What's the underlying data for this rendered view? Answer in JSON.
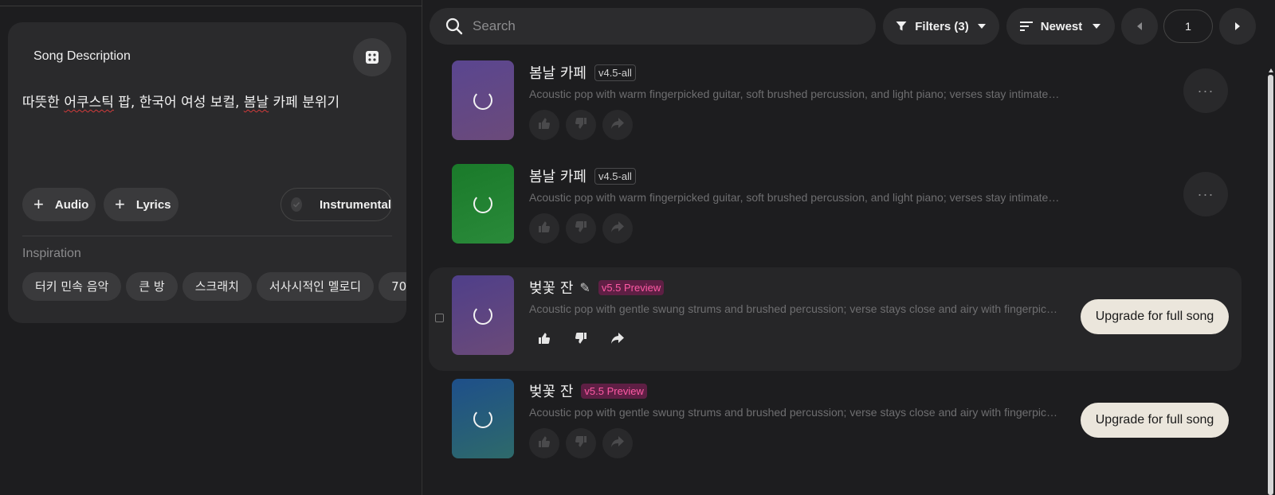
{
  "create_panel": {
    "title": "Song Description",
    "description": {
      "parts": [
        {
          "text": "따뜻한 ",
          "err": false
        },
        {
          "text": "어쿠스틱",
          "err": true
        },
        {
          "text": " 팝, 한국어 여성 보컬, ",
          "err": false
        },
        {
          "text": "봄날",
          "err": true
        },
        {
          "text": " 카페 분위기",
          "err": false
        }
      ]
    },
    "audio_label": "Audio",
    "lyrics_label": "Lyrics",
    "instrumental_label": "Instrumental",
    "inspiration_label": "Inspiration",
    "inspiration_chips": [
      "터키 민속 음악",
      "큰 방",
      "스크래치",
      "서사시적인 멜로디",
      "70"
    ]
  },
  "toolbar": {
    "search_placeholder": "Search",
    "filters_label": "Filters (3)",
    "sort_label": "Newest",
    "page": "1"
  },
  "songs": [
    {
      "title": "봄날 카페",
      "badge": "v4.5-all",
      "badge_style": "grey",
      "description": "Acoustic pop with warm fingerpicked guitar, soft brushed percussion, and light piano; verses stay intimate and warm while the chorus opens up with gentle harmonies",
      "cover": "#5a4690",
      "cover_end": "#6b4a7a",
      "action": "more",
      "highlight": false,
      "editable": false
    },
    {
      "title": "봄날 카페",
      "badge": "v4.5-all",
      "badge_style": "grey",
      "description": "Acoustic pop with warm fingerpicked guitar, soft brushed percussion, and light piano; verses stay intimate and warm while the chorus opens up with gentle harmonies",
      "cover": "#1a7a2a",
      "cover_end": "#2a8a3a",
      "action": "more",
      "highlight": false,
      "editable": false
    },
    {
      "title": "벚꽃 잔",
      "badge": "v5.5 Preview",
      "badge_style": "pink",
      "description": "Acoustic pop with gentle swung strums and brushed percussion; verse stays close and airy with fingerpicked guitar and soft vocals",
      "cover": "#4f3f8a",
      "cover_end": "#6b4a78",
      "action": "upgrade",
      "highlight": true,
      "editable": true
    },
    {
      "title": "벚꽃 잔",
      "badge": "v5.5 Preview",
      "badge_style": "pink",
      "description": "Acoustic pop with gentle swung strums and brushed percussion; verse stays close and airy with fingerpicked guitar and soft vocals",
      "cover": "#1e4f8a",
      "cover_end": "#2e6a6a",
      "action": "upgrade",
      "highlight": false,
      "editable": false
    }
  ],
  "upgrade_label": "Upgrade for full song",
  "more_label": "···"
}
